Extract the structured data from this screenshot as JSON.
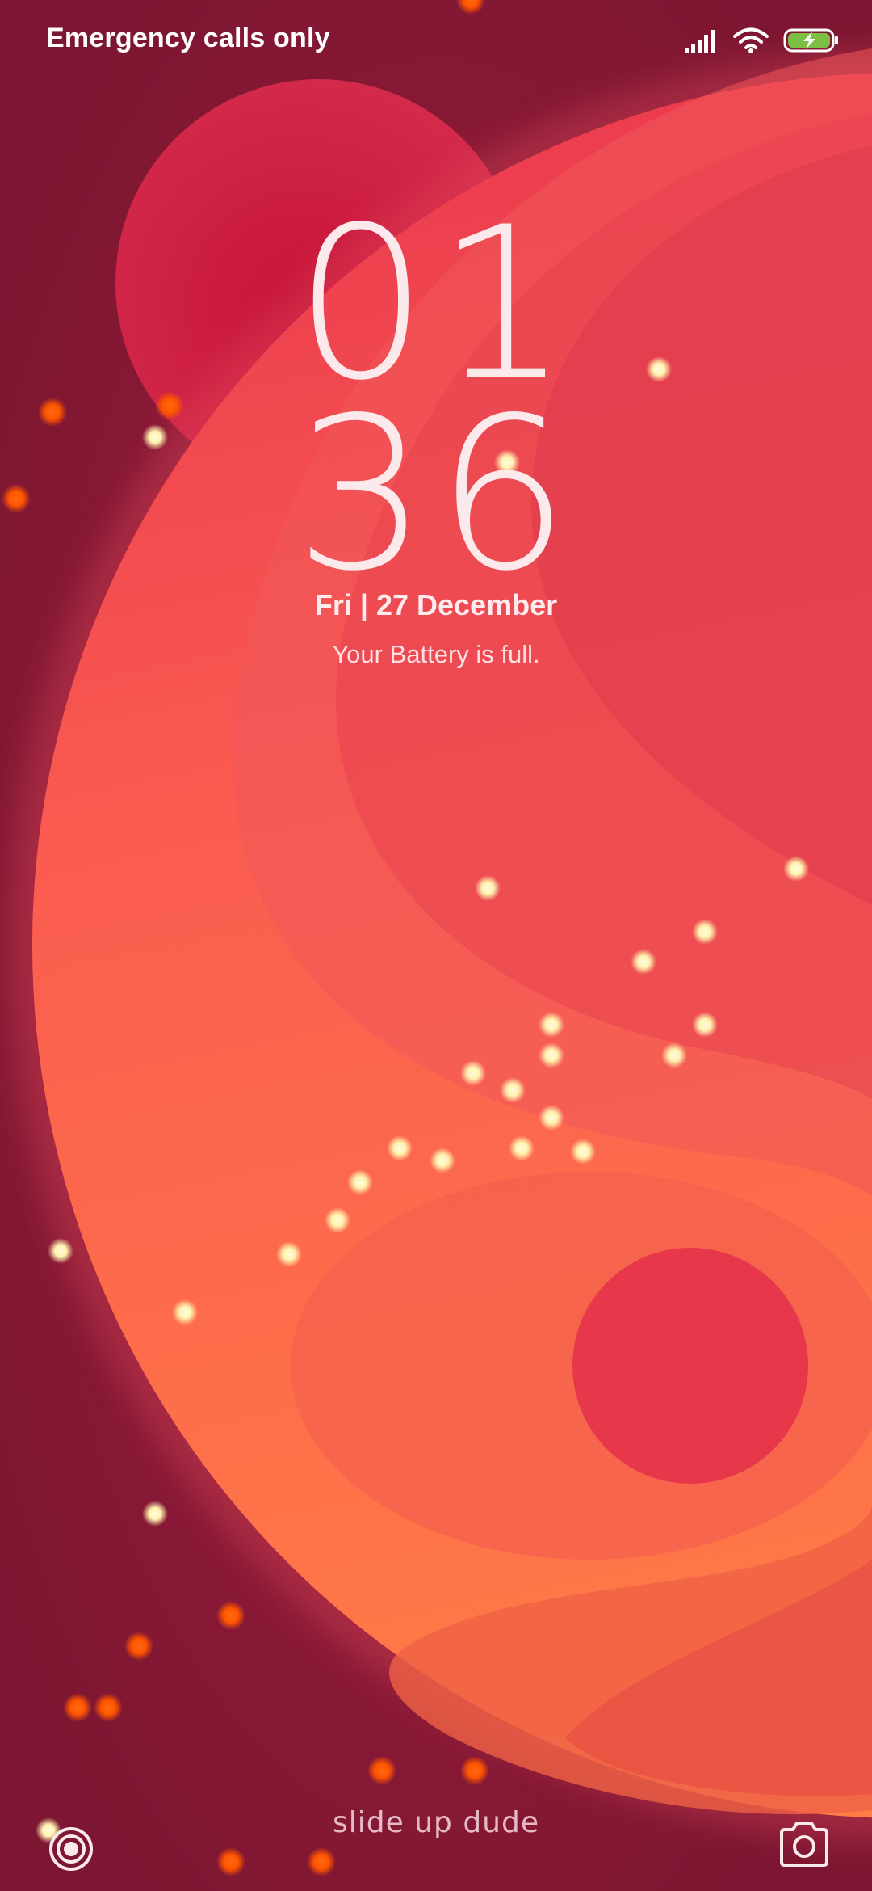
{
  "status_bar": {
    "carrier_text": "Emergency calls only",
    "icons": [
      "signal-icon",
      "wifi-icon",
      "battery-charging-icon"
    ],
    "battery_fill_color": "#7bc043"
  },
  "lock_screen": {
    "clock_hours": "01",
    "clock_minutes": "36",
    "date": "Fri | 27 December",
    "battery_message": "Your Battery is full.",
    "slide_hint": "slide up dude"
  },
  "shortcuts": {
    "left_icon": "torch-icon",
    "right_icon": "camera-icon"
  },
  "colors": {
    "background": "#8a1a35",
    "sphere_light": "#ff7a45",
    "sphere_dark": "#e5394f",
    "text": "#fbe9ec"
  }
}
